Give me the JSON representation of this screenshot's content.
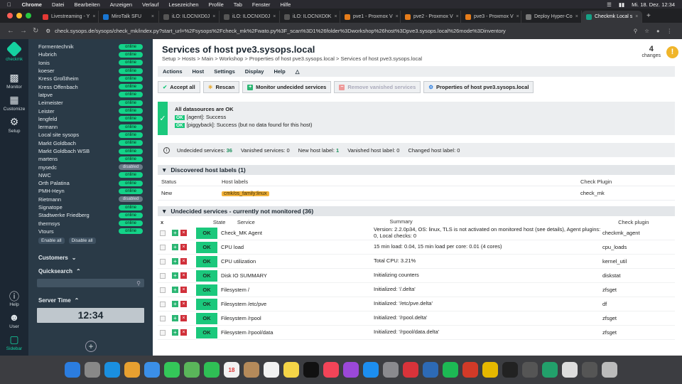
{
  "os_menubar": {
    "app": "Chrome",
    "items": [
      "Datei",
      "Bearbeiten",
      "Anzeigen",
      "Verlauf",
      "Lesezeichen",
      "Profile",
      "Tab",
      "Fenster",
      "Hilfe"
    ],
    "clock": "Mi. 18. Dez. 12:34"
  },
  "browser": {
    "tabs": [
      {
        "title": "Livestreaming - Y",
        "color": "#e53935"
      },
      {
        "title": "MiroTalk SFU",
        "color": "#1976d2"
      },
      {
        "title": "iLO: ILOCNXD0J",
        "color": "#555"
      },
      {
        "title": "iLO: ILOCNXD0J",
        "color": "#555"
      },
      {
        "title": "iLO: ILOCNXD0K",
        "color": "#555"
      },
      {
        "title": "pve1 - Proxmox V",
        "color": "#e57c1a"
      },
      {
        "title": "pve2 - Proxmox V",
        "color": "#e57c1a"
      },
      {
        "title": "pve3 - Proxmox V",
        "color": "#e57c1a"
      },
      {
        "title": "Deploy Hyper-Co",
        "color": "#777"
      },
      {
        "title": "Checkmk Local s",
        "color": "#16a085",
        "active": true
      }
    ],
    "url": "check.sysops.de/sysops/check_mk/index.py?start_url=%2Fsysops%2Fcheck_mk%2Fwato.py%3F_scan%3D1%26folder%3Dworkshop%26host%3Dpve3.sysops.local%26mode%3Dinventory"
  },
  "cmk_nav": {
    "logo": "checkmk",
    "items": [
      {
        "label": "Monitor",
        "icon": "bar-chart-icon"
      },
      {
        "label": "Customize",
        "icon": "grid-icon"
      },
      {
        "label": "Setup",
        "icon": "gear-icon"
      }
    ],
    "bottom": [
      {
        "label": "Help",
        "icon": "help-icon"
      },
      {
        "label": "User",
        "icon": "user-icon"
      },
      {
        "label": "Sidebar",
        "icon": "sidebar-icon"
      }
    ]
  },
  "sites": [
    {
      "name": "Formentechnik",
      "status": "online"
    },
    {
      "name": "Hubrich",
      "status": "online"
    },
    {
      "name": "Ionis",
      "status": "online"
    },
    {
      "name": "koeser",
      "status": "online"
    },
    {
      "name": "Kress Großtheim",
      "status": "online"
    },
    {
      "name": "Kress Offenbach",
      "status": "online"
    },
    {
      "name": "latpve",
      "status": "online"
    },
    {
      "name": "Leimeister",
      "status": "online"
    },
    {
      "name": "Leister",
      "status": "online"
    },
    {
      "name": "lengfeld",
      "status": "online"
    },
    {
      "name": "lermann",
      "status": "online"
    },
    {
      "name": "Local site sysops",
      "status": "online"
    },
    {
      "name": "Markt Goldbach",
      "status": "online"
    },
    {
      "name": "Markt Goldbach WSB",
      "status": "online"
    },
    {
      "name": "martens",
      "status": "online"
    },
    {
      "name": "mysedc",
      "status": "disabled"
    },
    {
      "name": "NWC",
      "status": "online"
    },
    {
      "name": "Orth Palatina",
      "status": "online"
    },
    {
      "name": "PMH-Heyn",
      "status": "online"
    },
    {
      "name": "Rietmann",
      "status": "disabled"
    },
    {
      "name": "Signatope",
      "status": "online"
    },
    {
      "name": "Stadtwerke Friedberg",
      "status": "online"
    },
    {
      "name": "thermsys",
      "status": "online"
    },
    {
      "name": "Vtours",
      "status": "online"
    }
  ],
  "site_buttons": {
    "enable": "Enable all",
    "disable": "Disable all"
  },
  "snapins": {
    "customers": "Customers",
    "quicksearch": "Quicksearch",
    "server_time": "Server Time",
    "time": "12:34"
  },
  "page": {
    "title": "Services of host pve3.sysops.local",
    "breadcrumb": "Setup > Hosts > Main > Workshop > Properties of host pve3.sysops.local > Services of host pve3.sysops.local",
    "changes_count": "4",
    "changes_label": "changes",
    "menu": [
      "Actions",
      "Host",
      "Settings",
      "Display",
      "Help"
    ],
    "buttons": {
      "accept": "Accept all",
      "rescan": "Rescan",
      "monitor": "Monitor undecided services",
      "remove": "Remove vanished services",
      "props": "Properties of host pve3.sysops.local"
    },
    "status": {
      "head": "All datasources are OK",
      "lines": [
        {
          "tag": "OK",
          "text": "[agent]: Success"
        },
        {
          "tag": "OK",
          "text": "[piggyback]: Success (but no data found for this host)"
        }
      ]
    },
    "info": {
      "undecided_label": "Undecided services:",
      "undecided": "36",
      "vanished_label": "Vanished services:",
      "vanished": "0",
      "newlabel_label": "New host label:",
      "newlabel": "1",
      "vanlabel_label": "Vanished host label:",
      "vanlabel": "0",
      "changed_label": "Changed host label:",
      "changed": "0"
    },
    "labels_section": {
      "title": "Discovered host labels (1)",
      "cols": [
        "Status",
        "Host labels",
        "Check Plugin"
      ],
      "row": {
        "status": "New",
        "label": "cmk/os_family:linux",
        "plugin": "check_mk"
      }
    },
    "services_section": {
      "title": "Undecided services - currently not monitored (36)",
      "cols": [
        "State",
        "Service",
        "Summary",
        "Check plugin"
      ],
      "rows": [
        {
          "state": "OK",
          "service": "Check_MK Agent",
          "summary": "Version: 2.2.0p34, OS: linux, TLS is not activated on monitored host (see details), Agent plugins: 0, Local checks: 0",
          "plugin": "checkmk_agent"
        },
        {
          "state": "OK",
          "service": "CPU load",
          "summary": "15 min load: 0.04, 15 min load per core: 0.01 (4 cores)",
          "plugin": "cpu_loads"
        },
        {
          "state": "OK",
          "service": "CPU utilization",
          "summary": "Total CPU: 3.21%",
          "plugin": "kernel_util"
        },
        {
          "state": "OK",
          "service": "Disk IO SUMMARY",
          "summary": "Initializing counters",
          "plugin": "diskstat"
        },
        {
          "state": "OK",
          "service": "Filesystem /",
          "summary": "Initialized: '/.delta'",
          "plugin": "zfsget"
        },
        {
          "state": "OK",
          "service": "Filesystem /etc/pve",
          "summary": "Initialized: '/etc/pve.delta'",
          "plugin": "df"
        },
        {
          "state": "OK",
          "service": "Filesystem /rpool",
          "summary": "Initialized: '/rpool.delta'",
          "plugin": "zfsget"
        },
        {
          "state": "OK",
          "service": "Filesystem /rpool/data",
          "summary": "Initialized: '/rpool/data.delta'",
          "plugin": "zfsget"
        }
      ]
    }
  },
  "dock": [
    {
      "name": "finder",
      "color": "#2b7de0"
    },
    {
      "name": "launchpad",
      "color": "#888"
    },
    {
      "name": "safari",
      "color": "#1a8fe0"
    },
    {
      "name": "photos",
      "color": "#e8a030"
    },
    {
      "name": "mail",
      "color": "#3b8fe8"
    },
    {
      "name": "messages",
      "color": "#34c759"
    },
    {
      "name": "maps",
      "color": "#5ab55a"
    },
    {
      "name": "facetime",
      "color": "#2fbf55"
    },
    {
      "name": "calendar",
      "color": "#f2f2f2",
      "label": "18"
    },
    {
      "name": "contacts",
      "color": "#b58a5a"
    },
    {
      "name": "reminders",
      "color": "#f2f2f2"
    },
    {
      "name": "notes",
      "color": "#f5d547"
    },
    {
      "name": "tv",
      "color": "#111"
    },
    {
      "name": "music",
      "color": "#f24458"
    },
    {
      "name": "podcasts",
      "color": "#9b48d8"
    },
    {
      "name": "appstore",
      "color": "#1c8ef0"
    },
    {
      "name": "settings",
      "color": "#8a8a8e"
    },
    {
      "name": "app",
      "color": "#d8333a"
    },
    {
      "name": "app2",
      "color": "#2d6ab5"
    },
    {
      "name": "spotify",
      "color": "#1db954"
    },
    {
      "name": "app3",
      "color": "#d23a28"
    },
    {
      "name": "chrome",
      "color": "#e6b800"
    },
    {
      "name": "terminal",
      "color": "#222"
    },
    {
      "name": "calculator",
      "color": "#555"
    },
    {
      "name": "app4",
      "color": "#22a06b"
    },
    {
      "name": "files",
      "color": "#ddd"
    },
    {
      "name": "app5",
      "color": "#555"
    },
    {
      "name": "trash",
      "color": "#bbb"
    }
  ]
}
